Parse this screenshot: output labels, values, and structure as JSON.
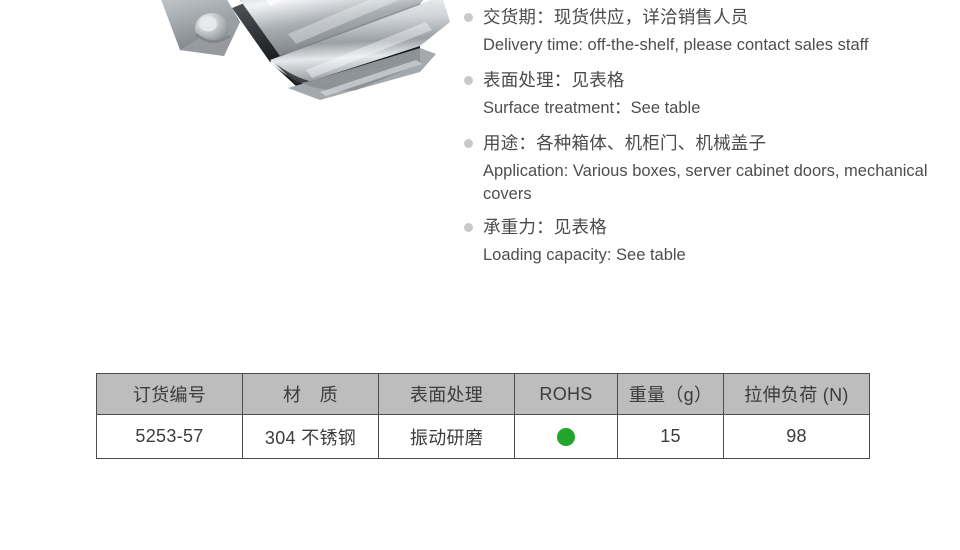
{
  "product_image": {
    "name": "stainless-steel-toggle-latch",
    "description": "Stainless steel toggle latch / draw latch photographed at an angle, cropped at top of frame",
    "finish_color": "#b9bcc0"
  },
  "spec_list": {
    "bullet_icon": "bullet-dot-icon",
    "items": [
      {
        "cn": "交货期：现货供应，详洽销售人员",
        "en": "Delivery time: off-the-shelf, please contact sales staff"
      },
      {
        "cn": "表面处理：见表格",
        "en": "Surface treatment：See table"
      },
      {
        "cn": "用途：各种箱体、机柜门、机械盖子",
        "en": "Application: Various boxes, server cabinet doors, mechanical covers"
      },
      {
        "cn": "承重力：见表格",
        "en": "Loading capacity: See table"
      }
    ]
  },
  "spec_table": {
    "headers": [
      "订货编号",
      "材　质",
      "表面处理",
      "ROHS",
      "重量（g）",
      "拉伸负荷 (N)"
    ],
    "rows": [
      {
        "order_number": "5253-57",
        "material": "304 不锈钢",
        "surface_treatment": "振动研磨",
        "rohs": "compliant",
        "rohs_icon": "green-dot-icon",
        "weight_g": "15",
        "tensile_load_n": "98"
      }
    ]
  },
  "colors": {
    "header_fill": "#bdbdbd",
    "border": "#4d4d4d",
    "rohs_green": "#22a52b",
    "bullet_gray": "#c9c9c9",
    "text": "#4a4a4a"
  }
}
